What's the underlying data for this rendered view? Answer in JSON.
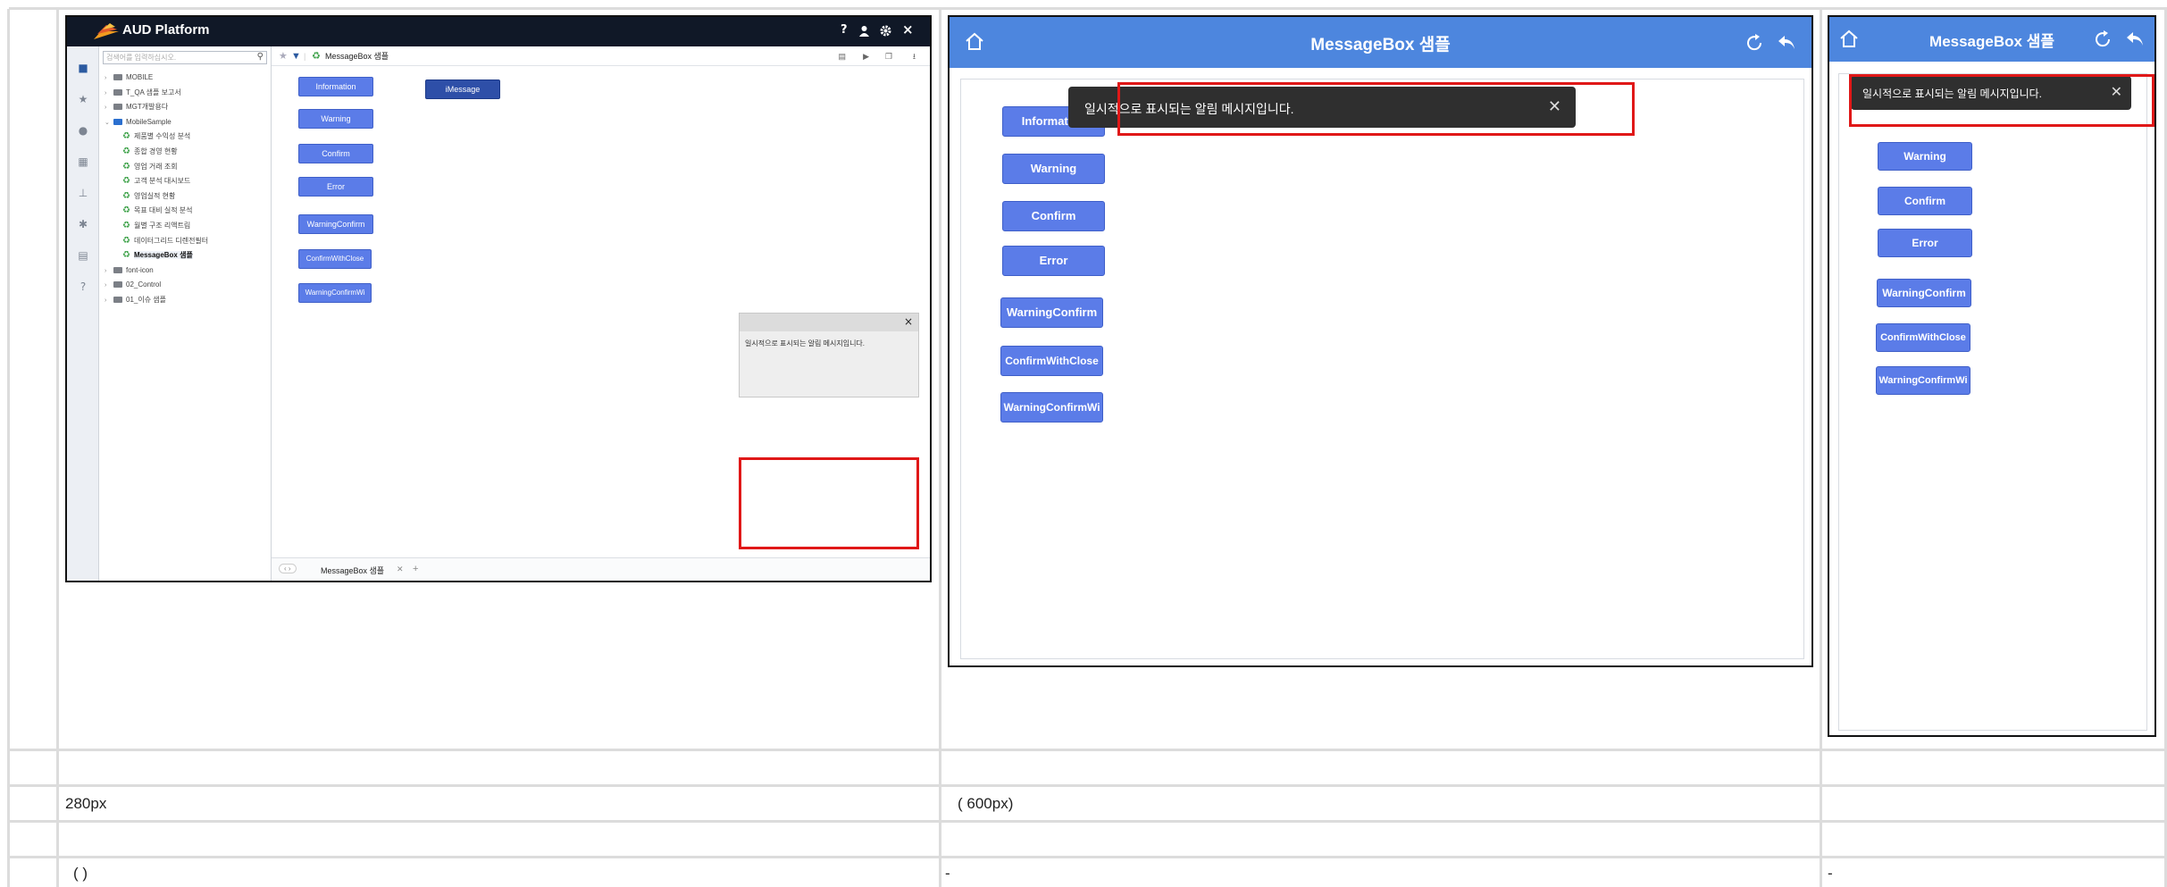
{
  "shot1": {
    "app_title": "AUD Platform",
    "topbar_icons": [
      "help-icon",
      "user-icon",
      "gear-icon",
      "close-icon"
    ],
    "search_placeholder": "검색어를 입력하십시오.",
    "tree": [
      {
        "label": "MOBILE",
        "type": "folder"
      },
      {
        "label": "T_QA 샘플 보고서",
        "type": "folder"
      },
      {
        "label": "MGT개발용다",
        "type": "folder"
      },
      {
        "label": "MobileSample",
        "type": "folder-open"
      },
      {
        "label": "제품별 수익성 분석",
        "type": "report"
      },
      {
        "label": "종합 경영 현황",
        "type": "report"
      },
      {
        "label": "영업 거래 조회",
        "type": "report"
      },
      {
        "label": "고객 분석 대시보드",
        "type": "report"
      },
      {
        "label": "영업실적 현황",
        "type": "report"
      },
      {
        "label": "목표 대비 실적 분석",
        "type": "report"
      },
      {
        "label": "월별 구조 리액트림",
        "type": "report"
      },
      {
        "label": "데이터그리드 디렌전필터",
        "type": "report"
      },
      {
        "label": "MessageBox 샘플",
        "type": "report",
        "selected": true
      },
      {
        "label": "font-icon",
        "type": "folder"
      },
      {
        "label": "02_Control",
        "type": "folder"
      },
      {
        "label": "01_이슈 샘플",
        "type": "folder"
      }
    ],
    "breadcrumb": "MessageBox 샘플",
    "buttons": [
      "Information",
      "Warning",
      "Confirm",
      "Error",
      "WarningConfirm",
      "ConfirmWithClose",
      "WarningConfirmWi"
    ],
    "imessage_button": "iMessage",
    "toast_message": "일시적으로 표시되는 알림 메시지입니다.",
    "tab_label": "MessageBox 샘플",
    "tab_nav": "‹ ›",
    "tab_add": "+",
    "tab_close": "✕",
    "help_glyph": "?",
    "close_glyph": "×"
  },
  "shot2": {
    "title": "MessageBox 샘플",
    "buttons": [
      "Information",
      "Warning",
      "Confirm",
      "Error",
      "WarningConfirm",
      "ConfirmWithClose",
      "WarningConfirmWi"
    ],
    "toast_message": "일시적으로 표시되는 알림 메시지입니다."
  },
  "shot3": {
    "title": "MessageBox 샘플",
    "buttons": [
      "Warning",
      "Confirm",
      "Error",
      "WarningConfirm",
      "ConfirmWithClose",
      "WarningConfirmWi"
    ],
    "toast_message": "일시적으로 표시되는 알림 메시지입니다."
  },
  "table": {
    "row3": {
      "c1": "280px",
      "c2": "( 600px)"
    },
    "row5": {
      "c1": "( )",
      "c2": "-",
      "c3": "-"
    }
  },
  "colors": {
    "header_blue": "#4d86de",
    "button_blue": "#5b7ce8",
    "highlight_red": "#e01818",
    "toast_dark": "#2f2f2f",
    "topbar": "#101827"
  }
}
